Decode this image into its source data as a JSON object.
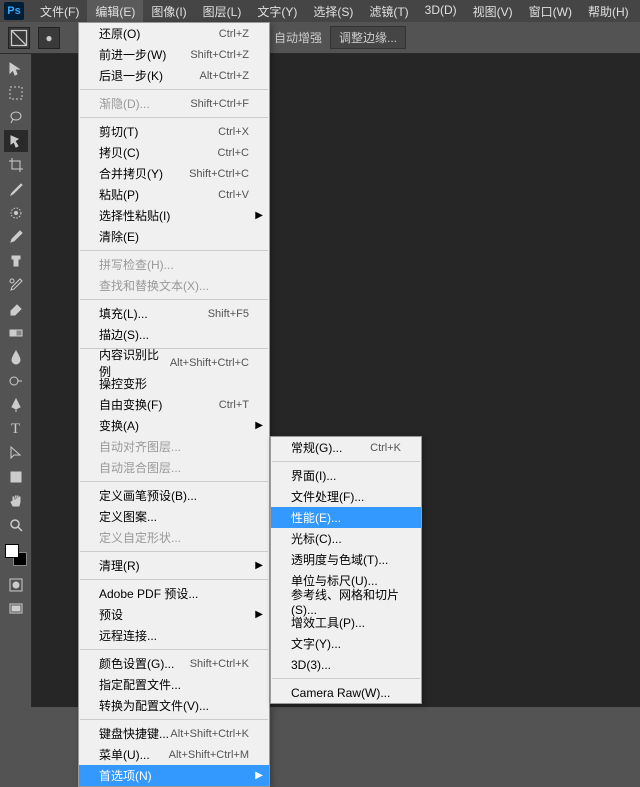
{
  "menubar": {
    "items": [
      "文件(F)",
      "编辑(E)",
      "图像(I)",
      "图层(L)",
      "文字(Y)",
      "选择(S)",
      "滤镜(T)",
      "3D(D)",
      "视图(V)",
      "窗口(W)",
      "帮助(H)"
    ],
    "active_index": 1
  },
  "options": {
    "auto_enhance": "自动增强",
    "adjust_edges": "调整边缘..."
  },
  "edit_menu": [
    {
      "t": "item",
      "label": "还原(O)",
      "sc": "Ctrl+Z"
    },
    {
      "t": "item",
      "label": "前进一步(W)",
      "sc": "Shift+Ctrl+Z"
    },
    {
      "t": "item",
      "label": "后退一步(K)",
      "sc": "Alt+Ctrl+Z"
    },
    {
      "t": "sep"
    },
    {
      "t": "item",
      "label": "渐隐(D)...",
      "sc": "Shift+Ctrl+F",
      "disabled": true
    },
    {
      "t": "sep"
    },
    {
      "t": "item",
      "label": "剪切(T)",
      "sc": "Ctrl+X"
    },
    {
      "t": "item",
      "label": "拷贝(C)",
      "sc": "Ctrl+C"
    },
    {
      "t": "item",
      "label": "合并拷贝(Y)",
      "sc": "Shift+Ctrl+C"
    },
    {
      "t": "item",
      "label": "粘贴(P)",
      "sc": "Ctrl+V"
    },
    {
      "t": "item",
      "label": "选择性粘贴(I)",
      "sub": true
    },
    {
      "t": "item",
      "label": "清除(E)"
    },
    {
      "t": "sep"
    },
    {
      "t": "item",
      "label": "拼写检查(H)...",
      "disabled": true
    },
    {
      "t": "item",
      "label": "查找和替换文本(X)...",
      "disabled": true
    },
    {
      "t": "sep"
    },
    {
      "t": "item",
      "label": "填充(L)...",
      "sc": "Shift+F5"
    },
    {
      "t": "item",
      "label": "描边(S)..."
    },
    {
      "t": "sep"
    },
    {
      "t": "item",
      "label": "内容识别比例",
      "sc": "Alt+Shift+Ctrl+C"
    },
    {
      "t": "item",
      "label": "操控变形"
    },
    {
      "t": "item",
      "label": "自由变换(F)",
      "sc": "Ctrl+T"
    },
    {
      "t": "item",
      "label": "变换(A)",
      "sub": true
    },
    {
      "t": "item",
      "label": "自动对齐图层...",
      "disabled": true
    },
    {
      "t": "item",
      "label": "自动混合图层...",
      "disabled": true
    },
    {
      "t": "sep"
    },
    {
      "t": "item",
      "label": "定义画笔预设(B)..."
    },
    {
      "t": "item",
      "label": "定义图案..."
    },
    {
      "t": "item",
      "label": "定义自定形状...",
      "disabled": true
    },
    {
      "t": "sep"
    },
    {
      "t": "item",
      "label": "清理(R)",
      "sub": true
    },
    {
      "t": "sep"
    },
    {
      "t": "item",
      "label": "Adobe PDF 预设..."
    },
    {
      "t": "item",
      "label": "预设",
      "sub": true
    },
    {
      "t": "item",
      "label": "远程连接..."
    },
    {
      "t": "sep"
    },
    {
      "t": "item",
      "label": "颜色设置(G)...",
      "sc": "Shift+Ctrl+K"
    },
    {
      "t": "item",
      "label": "指定配置文件..."
    },
    {
      "t": "item",
      "label": "转换为配置文件(V)..."
    },
    {
      "t": "sep"
    },
    {
      "t": "item",
      "label": "键盘快捷键...",
      "sc": "Alt+Shift+Ctrl+K"
    },
    {
      "t": "item",
      "label": "菜单(U)...",
      "sc": "Alt+Shift+Ctrl+M"
    },
    {
      "t": "item",
      "label": "首选项(N)",
      "sub": true,
      "hl": true
    }
  ],
  "prefs_menu": [
    {
      "t": "item",
      "label": "常规(G)...",
      "sc": "Ctrl+K"
    },
    {
      "t": "sep"
    },
    {
      "t": "item",
      "label": "界面(I)..."
    },
    {
      "t": "item",
      "label": "文件处理(F)..."
    },
    {
      "t": "item",
      "label": "性能(E)...",
      "hl": true
    },
    {
      "t": "item",
      "label": "光标(C)..."
    },
    {
      "t": "item",
      "label": "透明度与色域(T)..."
    },
    {
      "t": "item",
      "label": "单位与标尺(U)..."
    },
    {
      "t": "item",
      "label": "参考线、网格和切片(S)..."
    },
    {
      "t": "item",
      "label": "增效工具(P)..."
    },
    {
      "t": "item",
      "label": "文字(Y)..."
    },
    {
      "t": "item",
      "label": "3D(3)..."
    },
    {
      "t": "sep"
    },
    {
      "t": "item",
      "label": "Camera Raw(W)..."
    }
  ]
}
